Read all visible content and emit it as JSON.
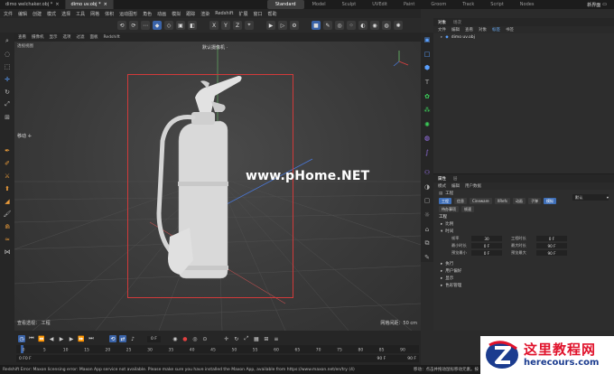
{
  "tabs": {
    "files": [
      {
        "label": "dimo welchaker.obj *",
        "active": false
      },
      {
        "label": "dimo uv.obj *",
        "active": true
      }
    ],
    "layouts": [
      {
        "label": "Standard",
        "active": true
      },
      {
        "label": "Model"
      },
      {
        "label": "Sculpt"
      },
      {
        "label": "UVEdit"
      },
      {
        "label": "Paint"
      },
      {
        "label": "Groom"
      },
      {
        "label": "Track"
      },
      {
        "label": "Script"
      },
      {
        "label": "Nodes"
      }
    ],
    "new_layout_label": "新界面"
  },
  "menubar": {
    "items": [
      "文件",
      "编辑",
      "创建",
      "模式",
      "选择",
      "工具",
      "网格",
      "体积",
      "运动图形",
      "角色",
      "动画",
      "模拟",
      "跟踪",
      "渲染",
      "Redshift",
      "扩展",
      "窗口",
      "帮助"
    ]
  },
  "viewport": {
    "menu": [
      "查看",
      "摄像机",
      "显示",
      "选项",
      "过滤",
      "面板",
      "Redshift"
    ],
    "corner_label": "透视视图",
    "camera_label": "默认摄像机 ·",
    "watermark": "www.pHome.NET",
    "move_label": "移动 ✛",
    "status_left": "查看透视： 工程",
    "status_right": "网格间距：50 cm"
  },
  "object_manager": {
    "tabs": [
      "对象",
      "场次"
    ],
    "menu": [
      "文件",
      "编辑",
      "查看",
      "对象",
      "标签",
      "书签"
    ],
    "highlight_menu": "标签",
    "object_name": "dimo uv.obj"
  },
  "attribute_manager": {
    "tabs": [
      "属性",
      "层"
    ],
    "menu": [
      "模式",
      "编辑",
      "用户数据"
    ],
    "project_label": "工程",
    "preset": "默认",
    "chips_row1": [
      "工程",
      "信息",
      "Cineware",
      "XRefs",
      "动画",
      "子弹",
      "模拟"
    ],
    "chips_row2": [
      "待办事项",
      "帧速"
    ],
    "section_title": "工程",
    "sections": [
      "比例",
      "时间",
      "执行",
      "用户偏好",
      "显示",
      "色彩管理"
    ],
    "fields": [
      {
        "label": "帧率",
        "value": "30",
        "label2": "工程时长",
        "value2": "0 F"
      },
      {
        "label": "最小时长",
        "value": "0 F",
        "label2": "最大时长",
        "value2": "90 F"
      },
      {
        "label": "预览最小",
        "value": "0 F",
        "label2": "预览最大",
        "value2": "90 F"
      }
    ]
  },
  "timeline": {
    "frame_field": "0 F",
    "ruler_ticks": [
      "0",
      "5",
      "10",
      "15",
      "20",
      "25",
      "30",
      "35",
      "40",
      "45",
      "50",
      "55",
      "60",
      "65",
      "70",
      "75",
      "80",
      "85",
      "90"
    ],
    "range_start": "0 F",
    "range_start2": "0 F",
    "range_end": "90 F",
    "range_end2": "90 F"
  },
  "status": {
    "message": "Redshift Error: Maxon licensing error: Maxon App service not available. Please make sure you have installed the Maxon App, available from https://www.maxon.net/en/try (4)",
    "right_text": "移动：点击并拖动鼠标移动元素。按"
  },
  "site_logo": {
    "cn": "这里教程网",
    "en": "herecours.com"
  },
  "colors": {
    "accent": "#3a63a8",
    "safe_frame": "#d23a3a",
    "logo_red": "#e0122b",
    "logo_blue": "#1b3c8f"
  }
}
